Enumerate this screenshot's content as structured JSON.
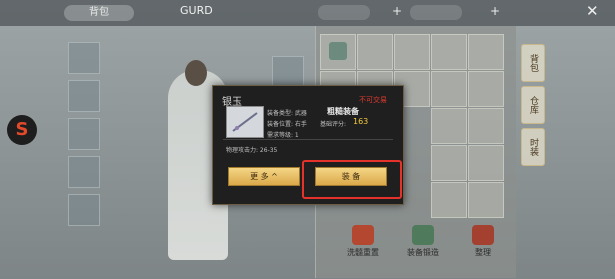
{
  "header": {
    "tab_label": "背包",
    "name_label": "GURD",
    "plus": "+",
    "close": "✕"
  },
  "popup": {
    "item_name": "银玉",
    "status": "不可交易",
    "type_line": "装备类型: 武器",
    "slot_line": "装备位置: 右手",
    "level_line": "需求等级: 1",
    "quality_line": "粗糙装备",
    "score_label": "基础评分:",
    "score_value": "163",
    "stat_line": "物理攻击力: 26-35",
    "more_button": "更 多 ^",
    "equip_button": "装 备"
  },
  "actions": {
    "a1": "洗髓重置",
    "a2": "装备锻造",
    "a3": "整理"
  },
  "side_tabs": [
    "背包",
    "仓库",
    "时装"
  ],
  "colors": {
    "highlight": "#e5322b",
    "score": "#f3c93e",
    "status": "#e13a2f"
  }
}
